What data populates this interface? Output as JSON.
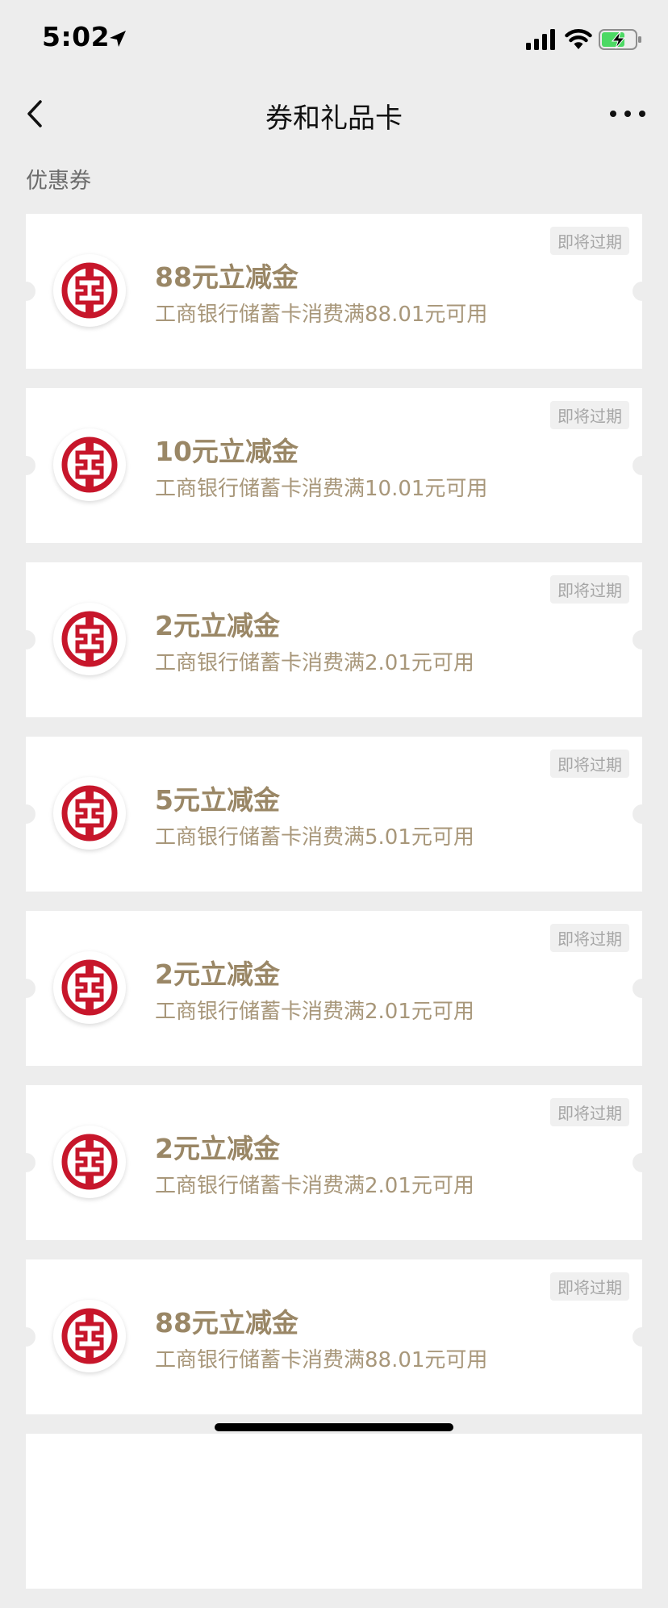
{
  "status_bar": {
    "time": "5:02"
  },
  "nav": {
    "title": "券和礼品卡"
  },
  "section": {
    "label": "优惠券"
  },
  "colors": {
    "accent_gold": "#9a8766",
    "icbc_red": "#c7162b",
    "battery_green": "#4cd964"
  },
  "coupons": [
    {
      "title": "88元立减金",
      "desc": "工商银行储蓄卡消费满88.01元可用",
      "badge": "即将过期",
      "icon": "icbc-logo-icon"
    },
    {
      "title": "10元立减金",
      "desc": "工商银行储蓄卡消费满10.01元可用",
      "badge": "即将过期",
      "icon": "icbc-logo-icon"
    },
    {
      "title": "2元立减金",
      "desc": "工商银行储蓄卡消费满2.01元可用",
      "badge": "即将过期",
      "icon": "icbc-logo-icon"
    },
    {
      "title": "5元立减金",
      "desc": "工商银行储蓄卡消费满5.01元可用",
      "badge": "即将过期",
      "icon": "icbc-logo-icon"
    },
    {
      "title": "2元立减金",
      "desc": "工商银行储蓄卡消费满2.01元可用",
      "badge": "即将过期",
      "icon": "icbc-logo-icon"
    },
    {
      "title": "2元立减金",
      "desc": "工商银行储蓄卡消费满2.01元可用",
      "badge": "即将过期",
      "icon": "icbc-logo-icon"
    },
    {
      "title": "88元立减金",
      "desc": "工商银行储蓄卡消费满88.01元可用",
      "badge": "即将过期",
      "icon": "icbc-logo-icon"
    }
  ]
}
